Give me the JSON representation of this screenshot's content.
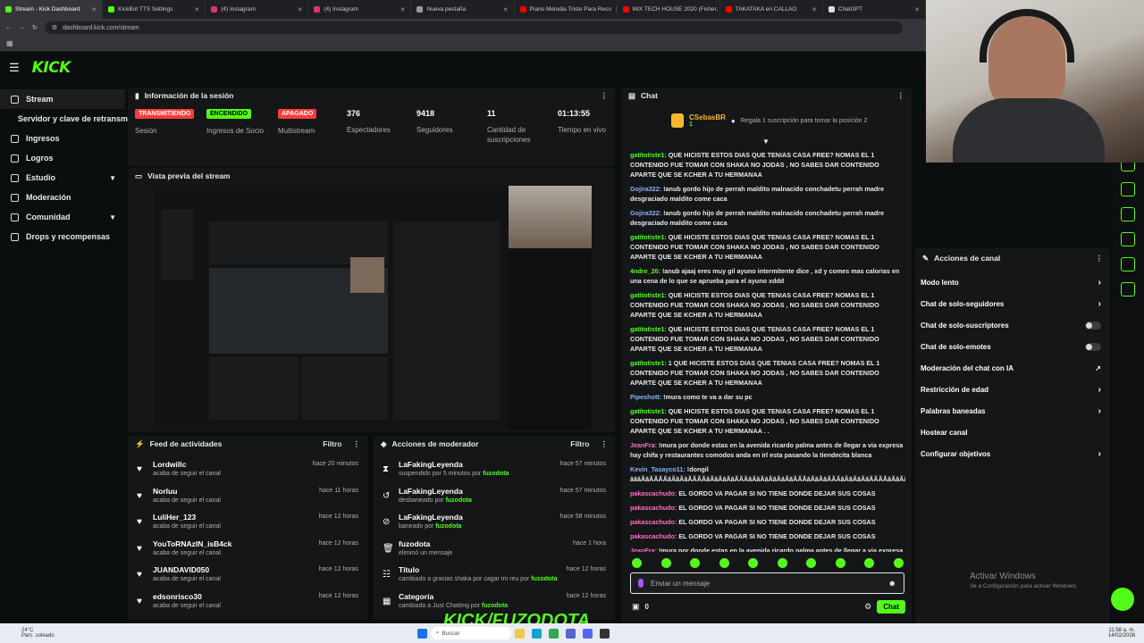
{
  "browser": {
    "tabs": [
      {
        "label": "Stream - Kick Dashboard",
        "active": true,
        "color": "#53fc18"
      },
      {
        "label": "KickBot TTS Settings",
        "active": false,
        "color": "#53fc18"
      },
      {
        "label": "(4) Instagram",
        "active": false,
        "color": "#e1306c"
      },
      {
        "label": "(4) Instagram",
        "active": false,
        "color": "#e1306c"
      },
      {
        "label": "Nueva pestaña",
        "active": false,
        "color": "#999999"
      },
      {
        "label": "Piano Melodia Triste Para Reco",
        "active": false,
        "color": "#ff0000"
      },
      {
        "label": "MIX TECH HOUSE 2020 (Fisher,",
        "active": false,
        "color": "#ff0000"
      },
      {
        "label": "TAKATAKA en CALLAO",
        "active": false,
        "color": "#ff0000"
      },
      {
        "label": "ChatGPT",
        "active": false,
        "color": "#dddddd"
      }
    ],
    "url": "dashboard.kick.com/stream"
  },
  "app": {
    "logo": "KICK",
    "sidebar": {
      "items": [
        {
          "label": "Stream",
          "active": true
        },
        {
          "label": "Servidor y clave de retransmisión",
          "sub": true
        },
        {
          "label": "Ingresos"
        },
        {
          "label": "Logros"
        },
        {
          "label": "Estudio",
          "chevron": true
        },
        {
          "label": "Moderación"
        },
        {
          "label": "Comunidad",
          "chevron": true
        },
        {
          "label": "Drops y recompensas"
        }
      ]
    },
    "session": {
      "title": "Información de la sesión",
      "badges": [
        {
          "value": "TRANSMITIENDO",
          "label": "Sesión",
          "color": "#ff3b3b"
        },
        {
          "value": "ENCENDIDO",
          "label": "Ingresos de Socio",
          "color": "#53fc18"
        },
        {
          "value": "APAGADO",
          "label": "Multistream",
          "color": "#ff3b3b"
        }
      ],
      "stats": [
        {
          "value": "376",
          "label": "Espectadores"
        },
        {
          "value": "9418",
          "label": "Seguidores"
        },
        {
          "value": "11",
          "label": "Cantidad de suscripciones"
        },
        {
          "value": "01:13:55",
          "label": "Tiempo en vivo"
        }
      ]
    },
    "preview": {
      "title": "Vista previa del stream"
    },
    "overlay_text": "KICK/FUZODOTA",
    "activity": {
      "title": "Feed de actividades",
      "filter": "Filtro",
      "rows": [
        {
          "name": "Lordwillc",
          "sub": "acaba de seguir el canal",
          "time": "hace 20 minutos"
        },
        {
          "name": "Norluu",
          "sub": "acaba de seguir el canal",
          "time": "hace 11 horas"
        },
        {
          "name": "LuliHer_123",
          "sub": "acaba de seguir el canal",
          "time": "hace 12 horas"
        },
        {
          "name": "YouToRNAzIN_isB4ck",
          "sub": "acaba de seguir el canal",
          "time": "hace 12 horas"
        },
        {
          "name": "JUANDAVID050",
          "sub": "acaba de seguir el canal",
          "time": "hace 12 horas"
        },
        {
          "name": "edsonrisco30",
          "sub": "acaba de seguir el canal",
          "time": "hace 12 horas"
        }
      ]
    },
    "modactions": {
      "title": "Acciones de moderador",
      "filter": "Filtro",
      "rows": [
        {
          "icon": "hourglass-icon",
          "name": "LaFakingLeyenda",
          "pre": "suspendido por 5 minutos por",
          "by": "fuzodota",
          "time": "hace 57 minutos"
        },
        {
          "icon": "undo-icon",
          "name": "LaFakingLeyenda",
          "pre": "desbaneado por",
          "by": "fuzodota",
          "time": "hace 57 minutos"
        },
        {
          "icon": "ban-icon",
          "name": "LaFakingLeyenda",
          "pre": "baneado por",
          "by": "fuzodota",
          "time": "hace 58 minutos"
        },
        {
          "icon": "trash-icon",
          "name": "fuzodota",
          "pre": "eliminó un mensaje",
          "by": "",
          "time": "hace 1 hora"
        },
        {
          "icon": "title-icon",
          "name": "Título",
          "pre": "cambiado a gracias shaka por cagar mi reu por",
          "by": "fuzodota",
          "time": "hace 12 horas"
        },
        {
          "icon": "category-icon",
          "name": "Categoría",
          "pre": "cambiado a Just Chatting por",
          "by": "fuzodota",
          "time": "hace 12 horas"
        }
      ]
    },
    "chat": {
      "title": "Chat",
      "pinned_user": "CSebasBR",
      "pinned_count": "1",
      "pinned_text": "Regala 1 suscripción para tomar la posición 2",
      "messages": [
        {
          "user": "gatitotiste1:",
          "color": "green",
          "text": "QUE HICISTE ESTOS DIAS QUE TENIAS CASA FREE? NOMAS EL 1 CONTENIDO FUE TOMAR CON SHAKA NO JODAS , NO SABES DAR CONTENIDO APARTE QUE SE KCHER A TU HERMANAA"
        },
        {
          "user": "Gojira322:",
          "color": "blue",
          "text": "!anub gordo hijo de perrah maldito malnacido conchadetu perrah madre desgraciado maldito come caca"
        },
        {
          "user": "Gojira322:",
          "color": "blue",
          "text": "!anub gordo hijo de perrah maldito malnacido conchadetu perrah madre desgraciado maldito come caca"
        },
        {
          "user": "gatitotiste1:",
          "color": "green",
          "text": "QUE HICISTE ESTOS DIAS QUE TENIAS CASA FREE? NOMAS EL 1 CONTENIDO FUE TOMAR CON SHAKA NO JODAS , NO SABES DAR CONTENIDO APARTE QUE SE KCHER A TU HERMANAA"
        },
        {
          "user": "4ndre_26:",
          "color": "green",
          "text": "!anub ajaaj eres muy gil ayuno intermitente dice , xd y comes mas calorias en una cena de lo que se aprueba para el ayuno xddd"
        },
        {
          "user": "gatitotiste1:",
          "color": "green",
          "text": "QUE HICISTE ESTOS DIAS QUE TENIAS CASA FREE? NOMAS EL 1 CONTENIDO FUE TOMAR CON SHAKA NO JODAS , NO SABES DAR CONTENIDO APARTE QUE SE KCHER A TU HERMANAA"
        },
        {
          "user": "gatitotiste1:",
          "color": "green",
          "text": "QUE HICISTE ESTOS DIAS QUE TENIAS CASA FREE? NOMAS EL 1 CONTENIDO FUE TOMAR CON SHAKA NO JODAS , NO SABES DAR CONTENIDO APARTE QUE SE KCHER A TU HERMANAA"
        },
        {
          "user": "gatitotiste1:",
          "color": "green",
          "text": "1 QUE HICISTE ESTOS DIAS QUE TENIAS CASA FREE? NOMAS EL 1 CONTENIDO FUE TOMAR CON SHAKA NO JODAS , NO SABES DAR CONTENIDO APARTE QUE SE KCHER A TU HERMANAA"
        },
        {
          "user": "Pipeshott:",
          "color": "blue",
          "text": "!mura como te va a dar su pc"
        },
        {
          "user": "gatitotiste1:",
          "color": "green",
          "text": "QUE HICISTE ESTOS DIAS QUE TENIAS CASA FREE? NOMAS EL 1 CONTENIDO FUE TOMAR CON SHAKA NO JODAS , NO SABES DAR CONTENIDO APARTE QUE SE KCHER A TU HERMANAA . ."
        },
        {
          "user": "JeanFra:",
          "color": "pink",
          "text": "!mura por donde estas en la avenida ricardo palma antes de llegar a via expresa hay chifa y restaurantes comodos anda en irl esta pasando la tiendecita blanca"
        },
        {
          "user": "Kevin_Tasayco11:",
          "color": "blue",
          "text": "!dongil ââãÃâÃÃÃÃãÃãÃâÃÃÃÃãÃãÃâÃãÃÃÃãÃãÃâÃãÃâÃãÃÃÃâÃãÃâÃÃÃãÃãÃâÃãÃÃÃÃãÃãÃâÃãÃâÃãÃÃÃãÃãÃâÃãÃâÃÃÃãÃãÃâÃãÃÃ"
        },
        {
          "user": "pakascachudo:",
          "color": "pink",
          "text": "EL GORDO VA PAGAR SI NO TIENE DONDE DEJAR SUS COSAS"
        },
        {
          "user": "pakascachudo:",
          "color": "pink",
          "text": "EL GORDO VA PAGAR SI NO TIENE DONDE DEJAR SUS COSAS"
        },
        {
          "user": "pakascachudo:",
          "color": "pink",
          "text": "EL GORDO VA PAGAR SI NO TIENE DONDE DEJAR SUS COSAS"
        },
        {
          "user": "pakascachudo:",
          "color": "pink",
          "text": "EL GORDO VA PAGAR SI NO TIENE DONDE DEJAR SUS COSAS"
        },
        {
          "user": "JeanFra:",
          "color": "pink",
          "text": "!mura por donde estas en la avenida ricardo palma antes de llegar a via expresa hay chifa y restaurantes comodos anda en irl esta pasando la tiendecita blanca"
        }
      ],
      "input_placeholder": "Enviar un mensaje",
      "count": "0",
      "send_label": "Chat"
    },
    "channel_actions": {
      "title": "Acciones de canal",
      "items": [
        {
          "label": "Modo lento",
          "control": "arrow"
        },
        {
          "label": "Chat de solo-seguidores",
          "control": "arrow"
        },
        {
          "label": "Chat de solo-suscriptores",
          "control": "toggle"
        },
        {
          "label": "Chat de solo-emotes",
          "control": "toggle"
        },
        {
          "label": "Moderación del chat con IA",
          "control": "external"
        },
        {
          "label": "Restricción de edad",
          "control": "arrow"
        },
        {
          "label": "Palabras baneadas",
          "control": "arrow"
        },
        {
          "label": "Hostear canal",
          "control": "none"
        },
        {
          "label": "Configurar objetivos",
          "control": "arrow"
        }
      ]
    }
  },
  "windows": {
    "activate_title": "Activar Windows",
    "activate_sub": "Ve a Configuración para activar Windows.",
    "weather_temp": "24°C",
    "weather_desc": "Parc. soleado",
    "search_placeholder": "Buscar",
    "time": "11:58 a. m.",
    "date": "14/02/2026"
  }
}
